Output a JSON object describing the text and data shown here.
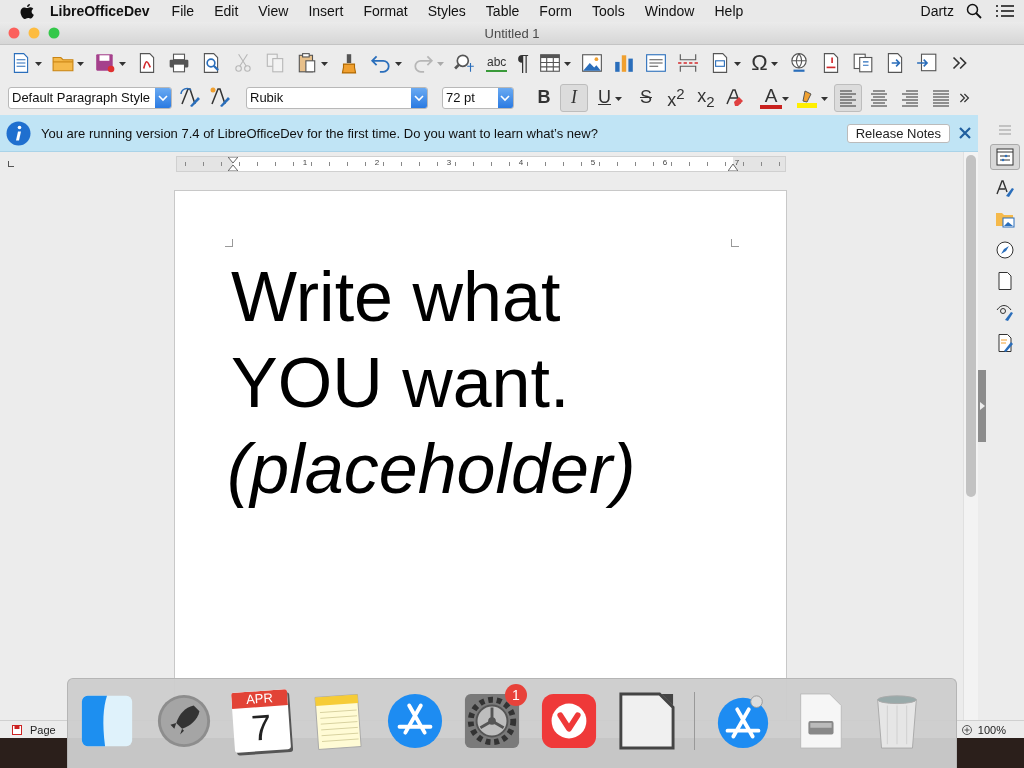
{
  "menu_bar": {
    "app_name": "LibreOfficeDev",
    "menus": [
      "File",
      "Edit",
      "View",
      "Insert",
      "Format",
      "Styles",
      "Table",
      "Form",
      "Tools",
      "Window",
      "Help"
    ],
    "user": "Dartz"
  },
  "window": {
    "title": "Untitled 1"
  },
  "standard_toolbar": [
    {
      "kind": "new",
      "disabled": false,
      "dropdown": true
    },
    {
      "kind": "open",
      "disabled": false,
      "dropdown": true
    },
    {
      "kind": "save",
      "disabled": false,
      "dropdown": true
    },
    {
      "kind": "pdf",
      "disabled": false,
      "dropdown": false
    },
    {
      "kind": "print",
      "disabled": false,
      "dropdown": false
    },
    {
      "kind": "preview",
      "disabled": false,
      "dropdown": false
    },
    {
      "kind": "cut",
      "disabled": true,
      "dropdown": false
    },
    {
      "kind": "copy",
      "disabled": true,
      "dropdown": false
    },
    {
      "kind": "paste",
      "disabled": false,
      "dropdown": true
    },
    {
      "kind": "clone",
      "disabled": false,
      "dropdown": false
    },
    {
      "kind": "undo",
      "disabled": false,
      "dropdown": true
    },
    {
      "kind": "redo",
      "disabled": true,
      "dropdown": true
    },
    {
      "kind": "find",
      "disabled": false,
      "dropdown": false
    },
    {
      "kind": "spelling",
      "text": "abc",
      "disabled": false,
      "dropdown": false
    },
    {
      "kind": "marks",
      "text": "¶",
      "disabled": false,
      "dropdown": false
    },
    {
      "kind": "table",
      "disabled": false,
      "dropdown": true
    },
    {
      "kind": "image",
      "disabled": false,
      "dropdown": false
    },
    {
      "kind": "chart",
      "disabled": false,
      "dropdown": false
    },
    {
      "kind": "textbox",
      "disabled": false,
      "dropdown": false
    },
    {
      "kind": "pagebreak",
      "disabled": false,
      "dropdown": false
    },
    {
      "kind": "field",
      "disabled": false,
      "dropdown": true
    },
    {
      "kind": "special",
      "text": "Ω",
      "disabled": false,
      "dropdown": true
    },
    {
      "kind": "hyperlink",
      "disabled": false,
      "dropdown": false
    },
    {
      "kind": "footnote",
      "disabled": false,
      "dropdown": false
    },
    {
      "kind": "comment",
      "disabled": false,
      "dropdown": false
    },
    {
      "kind": "track",
      "disabled": false,
      "dropdown": false
    },
    {
      "kind": "insert",
      "disabled": false,
      "dropdown": false
    },
    {
      "kind": "more",
      "disabled": false,
      "dropdown": false
    }
  ],
  "formatting_toolbar": {
    "paragraph_style": "Default Paragraph Style",
    "font_name": "Rubik",
    "font_size": "72 pt",
    "text_buttons": [
      {
        "kind": "bold",
        "text": "B",
        "selected": false,
        "dropdown": false
      },
      {
        "kind": "italic",
        "text": "I",
        "selected": true,
        "dropdown": false
      },
      {
        "kind": "underline",
        "text": "U",
        "selected": false,
        "dropdown": true
      },
      {
        "kind": "strike",
        "text": "S",
        "selected": false,
        "dropdown": false
      },
      {
        "kind": "superscript",
        "text": "x$^{2}$",
        "selected": false,
        "dropdown": false
      },
      {
        "kind": "subscript",
        "text": "x$_{2}$",
        "selected": false,
        "dropdown": false
      }
    ],
    "font_color_label": "A",
    "alignments": [
      {
        "kind": "left",
        "selected": true
      },
      {
        "kind": "center",
        "selected": false
      },
      {
        "kind": "right",
        "selected": false
      },
      {
        "kind": "justify",
        "selected": false
      }
    ]
  },
  "infobar": {
    "message": "You are running version 7.4 of LibreOfficeDev for the first time. Do you want to learn what’s new?",
    "button": "Release Notes"
  },
  "ruler": {
    "labels": [
      "1",
      "2",
      "3",
      "4",
      "5",
      "6",
      "7"
    ]
  },
  "document": {
    "lines": [
      {
        "text": "Write what",
        "italic": false
      },
      {
        "text": "YOU want.",
        "italic": false
      },
      {
        "text": "(placeholder)",
        "italic": true
      }
    ]
  },
  "sidebar": [
    {
      "kind": "properties",
      "selected": true
    },
    {
      "kind": "styles",
      "selected": false
    },
    {
      "kind": "gallery",
      "selected": false
    },
    {
      "kind": "navigator",
      "selected": false
    },
    {
      "kind": "page",
      "selected": false
    },
    {
      "kind": "inspector",
      "selected": false
    },
    {
      "kind": "changes",
      "selected": false
    }
  ],
  "status_bar": {
    "page_label": "Page",
    "zoom": "100%"
  },
  "dock": [
    {
      "kind": "finder"
    },
    {
      "kind": "launchpad"
    },
    {
      "kind": "calendar",
      "month": "APR",
      "day": "7"
    },
    {
      "kind": "notes"
    },
    {
      "kind": "appstore"
    },
    {
      "kind": "settings",
      "badge": "1"
    },
    {
      "kind": "vivaldi"
    },
    {
      "kind": "libreoffice"
    },
    {
      "kind": "separator"
    },
    {
      "kind": "downloads"
    },
    {
      "kind": "file"
    },
    {
      "kind": "trash"
    }
  ]
}
